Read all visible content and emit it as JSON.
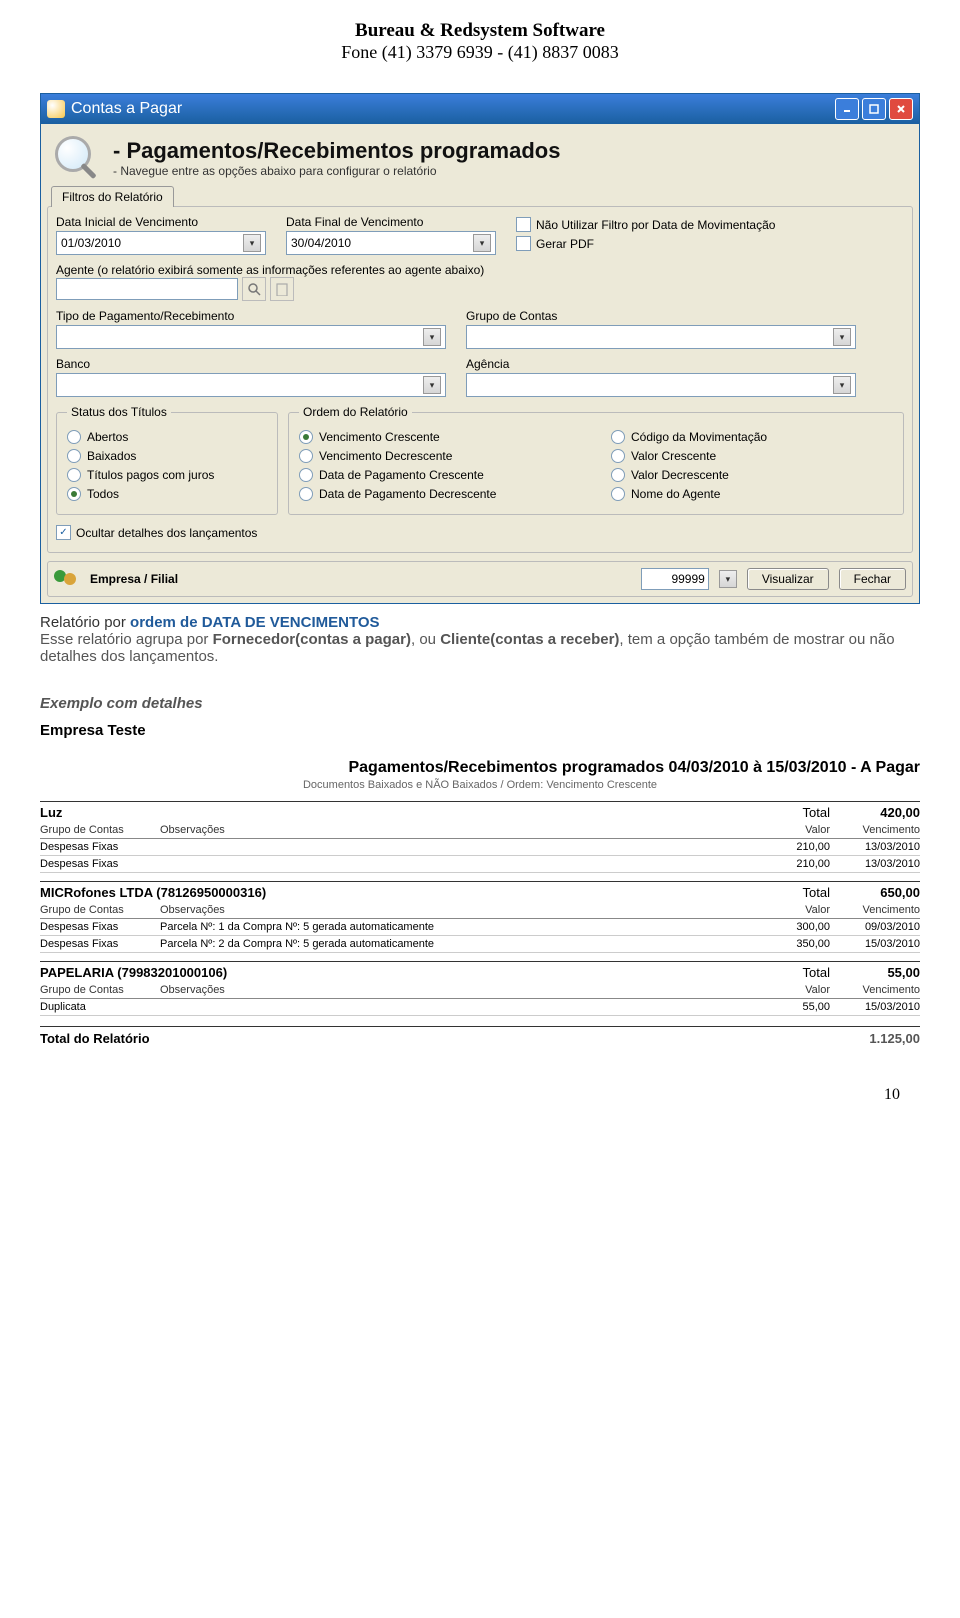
{
  "header": {
    "company": "Bureau & Redsystem Software",
    "phone": "Fone (41) 3379 6939 - (41) 8837 0083"
  },
  "window": {
    "title": "Contas a Pagar",
    "main_title": "- Pagamentos/Recebimentos programados",
    "subtitle": "- Navegue entre as opções abaixo para configurar o relatório",
    "tab": "Filtros do Relatório",
    "labels": {
      "data_ini": "Data Inicial de Vencimento",
      "data_fim": "Data Final de Vencimento",
      "nao_utilizar": "Não Utilizar Filtro por Data de Movimentação",
      "gerar_pdf": "Gerar PDF",
      "agente": "Agente (o relatório exibirá somente as informações referentes ao agente abaixo)",
      "tipo": "Tipo de Pagamento/Recebimento",
      "grupo": "Grupo de Contas",
      "banco": "Banco",
      "agencia": "Agência",
      "status_legend": "Status dos Títulos",
      "ordem_legend": "Ordem do Relatório",
      "ocultar": "Ocultar detalhes dos lançamentos",
      "empresa_filial": "Empresa / Filial",
      "visualizar": "Visualizar",
      "fechar": "Fechar"
    },
    "values": {
      "data_ini": "01/03/2010",
      "data_fim": "30/04/2010",
      "empresa_num": "99999"
    },
    "status_options": [
      "Abertos",
      "Baixados",
      "Títulos pagos com juros",
      "Todos"
    ],
    "status_selected": 3,
    "ordem_col1": [
      "Vencimento Crescente",
      "Vencimento Decrescente",
      "Data de Pagamento Crescente",
      "Data de Pagamento Decrescente"
    ],
    "ordem_col2": [
      "Código da Movimentação",
      "Valor Crescente",
      "Valor Decrescente",
      "Nome do Agente"
    ],
    "ordem_selected": 0
  },
  "caption": {
    "prefix": "Relatório por ",
    "bold_blue": "ordem de DATA DE VENCIMENTOS",
    "line2a": "Esse relatório agrupa por ",
    "line2b": "Fornecedor(contas a pagar)",
    "line2c": ", ou ",
    "line2d": "Cliente(contas a receber)",
    "line2e": ", tem a opção também de mostrar ou não detalhes dos lançamentos."
  },
  "example_label": "Exemplo com detalhes",
  "report": {
    "company": "Empresa Teste",
    "title": "Pagamentos/Recebimentos programados 04/03/2010 à 15/03/2010 - A Pagar",
    "subtitle": "Documentos Baixados e NÃO Baixados / Ordem: Vencimento Crescente",
    "col_grupo": "Grupo de Contas",
    "col_obs": "Observações",
    "col_valor": "Valor",
    "col_venc": "Vencimento",
    "col_total": "Total",
    "groups": [
      {
        "name": "Luz",
        "total": "420,00",
        "rows": [
          {
            "grupo": "Despesas Fixas",
            "obs": "",
            "valor": "210,00",
            "venc": "13/03/2010"
          },
          {
            "grupo": "Despesas Fixas",
            "obs": "",
            "valor": "210,00",
            "venc": "13/03/2010"
          }
        ]
      },
      {
        "name": "MICRofones LTDA (78126950000316)",
        "total": "650,00",
        "rows": [
          {
            "grupo": "Despesas Fixas",
            "obs": "Parcela Nº: 1 da Compra Nº: 5 gerada automaticamente",
            "valor": "300,00",
            "venc": "09/03/2010"
          },
          {
            "grupo": "Despesas Fixas",
            "obs": "Parcela Nº: 2 da Compra Nº: 5 gerada automaticamente",
            "valor": "350,00",
            "venc": "15/03/2010"
          }
        ]
      },
      {
        "name": "PAPELARIA (79983201000106)",
        "total": "55,00",
        "rows": [
          {
            "grupo": "Duplicata",
            "obs": "",
            "valor": "55,00",
            "venc": "15/03/2010"
          }
        ]
      }
    ],
    "total_label": "Total do Relatório",
    "total_value": "1.125,00"
  },
  "page_number": "10"
}
